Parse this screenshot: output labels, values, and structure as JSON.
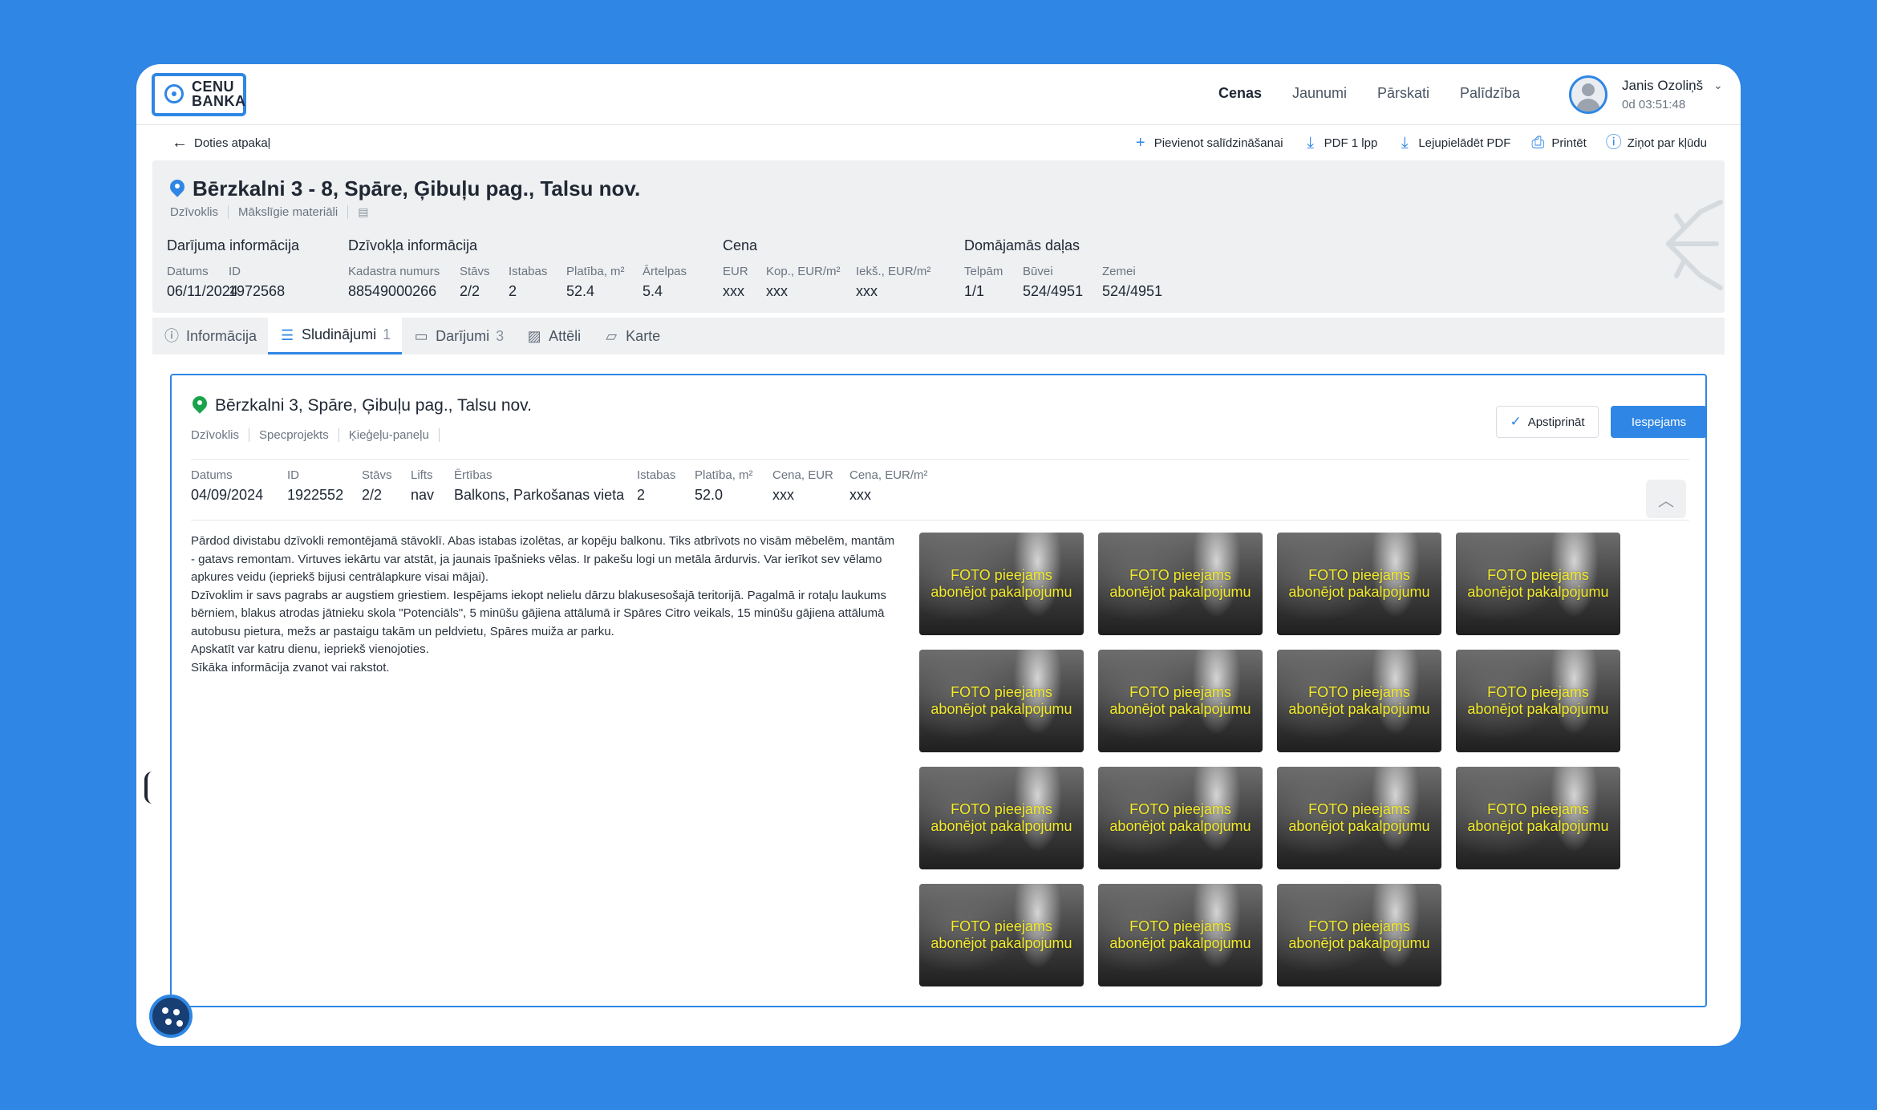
{
  "brand": {
    "line1": "CENU",
    "line2": "BANKA"
  },
  "nav": [
    {
      "label": "Cenas",
      "active": true
    },
    {
      "label": "Jaunumi",
      "active": false
    },
    {
      "label": "Pārskati",
      "active": false
    },
    {
      "label": "Palīdzība",
      "active": false
    }
  ],
  "user": {
    "name": "Janis Ozoliņš",
    "time": "0d 03:51:48"
  },
  "toolbar": {
    "back": "Doties atpakaļ",
    "add_compare": "Pievienot salīdzināšanai",
    "pdf_1": "PDF 1 lpp",
    "download_pdf": "Lejupielādēt PDF",
    "print": "Printēt",
    "report": "Ziņot par kļūdu"
  },
  "property": {
    "title": "Bērzkalni 3 - 8, Spāre, Ģibuļu pag., Talsu nov.",
    "tags": [
      "Dzīvoklis",
      "Mākslīgie materiāli"
    ],
    "transaction": {
      "section": "Darījuma informācija",
      "date_label": "Datums",
      "date": "06/11/2024",
      "id_label": "ID",
      "id": "1972568"
    },
    "apartment": {
      "section": "Dzīvokļa informācija",
      "cadastre_label": "Kadastra numurs",
      "cadastre": "88549000266",
      "floor_label": "Stāvs",
      "floor": "2/2",
      "rooms_label": "Istabas",
      "rooms": "2",
      "area_label": "Platība, m²",
      "area": "52.4",
      "outer_label": "Ārtelpas",
      "outer": "5.4"
    },
    "price": {
      "section": "Cena",
      "eur_label": "EUR",
      "eur": "xxx",
      "total_label": "Kop., EUR/m²",
      "total": "xxx",
      "inner_label": "Iekš., EUR/m²",
      "inner": "xxx"
    },
    "shares": {
      "section": "Domājamās daļas",
      "room_label": "Telpām",
      "room": "1/1",
      "building_label": "Būvei",
      "building": "524/4951",
      "land_label": "Zemei",
      "land": "524/4951"
    }
  },
  "tabs": [
    {
      "label": "Informācija",
      "count": "",
      "active": false,
      "icon": "info-icon"
    },
    {
      "label": "Sludinājumi",
      "count": "1",
      "active": true,
      "icon": "list-icon"
    },
    {
      "label": "Darījumi",
      "count": "3",
      "active": false,
      "icon": "folder-icon"
    },
    {
      "label": "Attēli",
      "count": "",
      "active": false,
      "icon": "image-icon"
    },
    {
      "label": "Karte",
      "count": "",
      "active": false,
      "icon": "map-icon"
    }
  ],
  "listing": {
    "title": "Bērzkalni 3, Spāre, Ģibuļu pag., Talsu nov.",
    "tags": [
      "Dzīvoklis",
      "Specprojekts",
      "Ķieģeļu-paneļu"
    ],
    "approve": "Apstiprināt",
    "option": "Iespejams",
    "fields": {
      "date_label": "Datums",
      "date": "04/09/2024",
      "id_label": "ID",
      "id": "1922552",
      "floor_label": "Stāvs",
      "floor": "2/2",
      "lift_label": "Lifts",
      "lift": "nav",
      "amen_label": "Ērtības",
      "amen": "Balkons, Parkošanas vieta",
      "rooms_label": "Istabas",
      "rooms": "2",
      "area_label": "Platība, m²",
      "area": "52.0",
      "price_label": "Cena, EUR",
      "price": "xxx",
      "ppm_label": "Cena, EUR/m²",
      "ppm": "xxx"
    },
    "description": [
      "Pārdod divistabu dzīvokli remontējamā stāvoklī. Abas istabas izolētas, ar kopēju balkonu. Tiks atbrīvots no visām mēbelēm, mantām - gatavs remontam. Virtuves iekārtu var atstāt, ja jaunais īpašnieks vēlas. Ir pakešu logi un metāla ārdurvis. Var ierīkot sev vēlamo apkures veidu (iepriekš bijusi centrālapkure visai mājai).",
      "Dzīvoklim ir savs pagrabs ar augstiem griestiem. Iespējams iekopt nelielu dārzu blakusesošajā teritorijā. Pagalmā ir rotaļu laukums bērniem, blakus atrodas jātnieku skola \"Potenciāls\", 5 minūšu gājiena attālumā ir Spāres Citro veikals, 15 minūšu gājiena attālumā autobusu pietura, mežs ar pastaigu takām un peldvietu, Spāres muiža ar parku.",
      "Apskatīt var katru dienu, iepriekš vienojoties.",
      "Sīkāka informācija zvanot vai rakstot."
    ],
    "photo_line1": "FOTO pieejams",
    "photo_line2": "abonējot pakalpojumu",
    "photo_count": 15
  },
  "colors": {
    "accent": "#2f86e4",
    "pin_listing": "#1aa34a",
    "overlay_text": "#f2ea2a"
  }
}
